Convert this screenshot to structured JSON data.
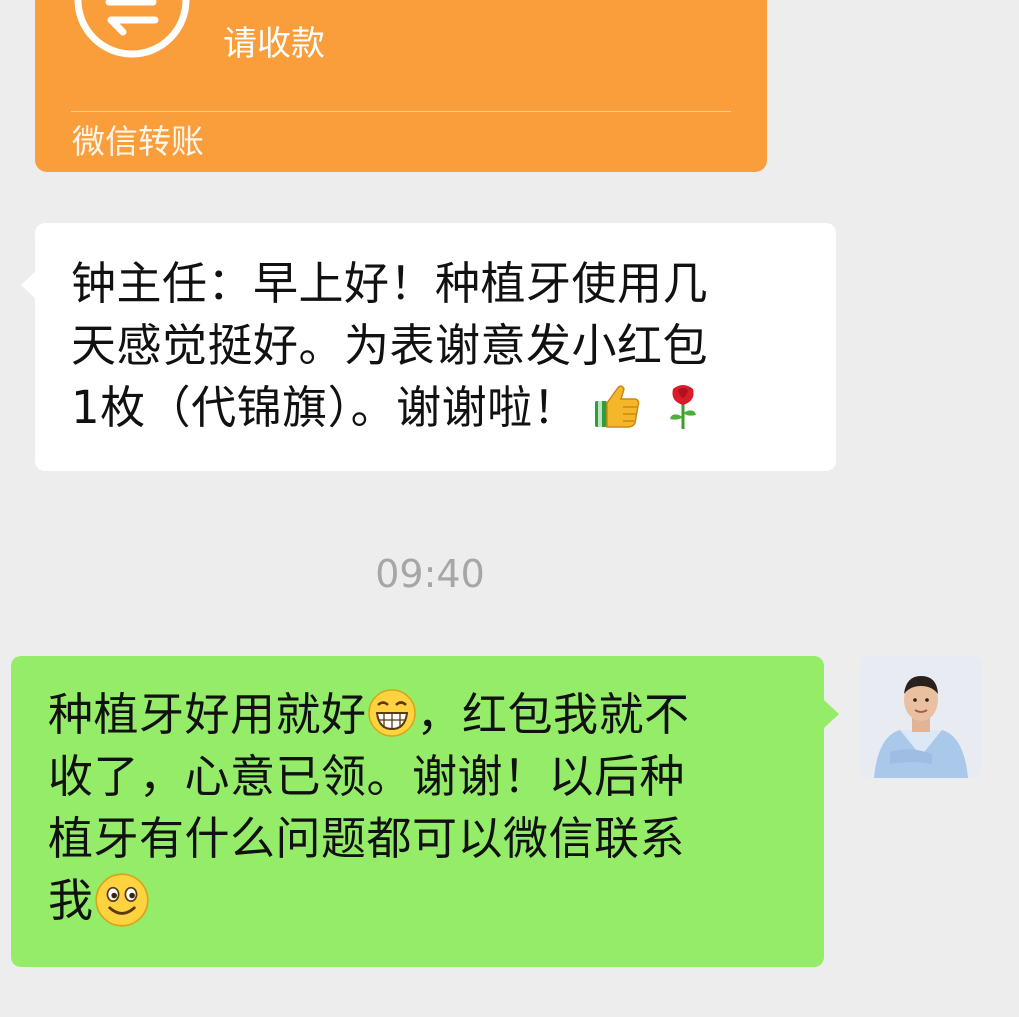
{
  "transfer": {
    "title": "请收款",
    "footer": "微信转账",
    "icon": "transfer-arrows-icon",
    "color": "#f99e3b"
  },
  "incoming": {
    "line1": "钟主任：早上好！种植牙使用几",
    "line2": "天感觉挺好。为表谢意发小红包",
    "line3": "1枚（代锦旗）。谢谢啦！",
    "emojis": [
      "thumbs-up-icon",
      "rose-icon"
    ]
  },
  "timestamp": "09:40",
  "outgoing": {
    "line1a": "种植牙好用就好",
    "line1b": "，红包我就不",
    "line2": "收了，心意已领。谢谢！以后种",
    "line3": "植牙有什么问题都可以微信联系",
    "line4": "我",
    "emojis": [
      "grin-face-icon",
      "smile-face-icon"
    ],
    "color": "#95ec69"
  },
  "avatar": {
    "name": "doctor-avatar"
  }
}
